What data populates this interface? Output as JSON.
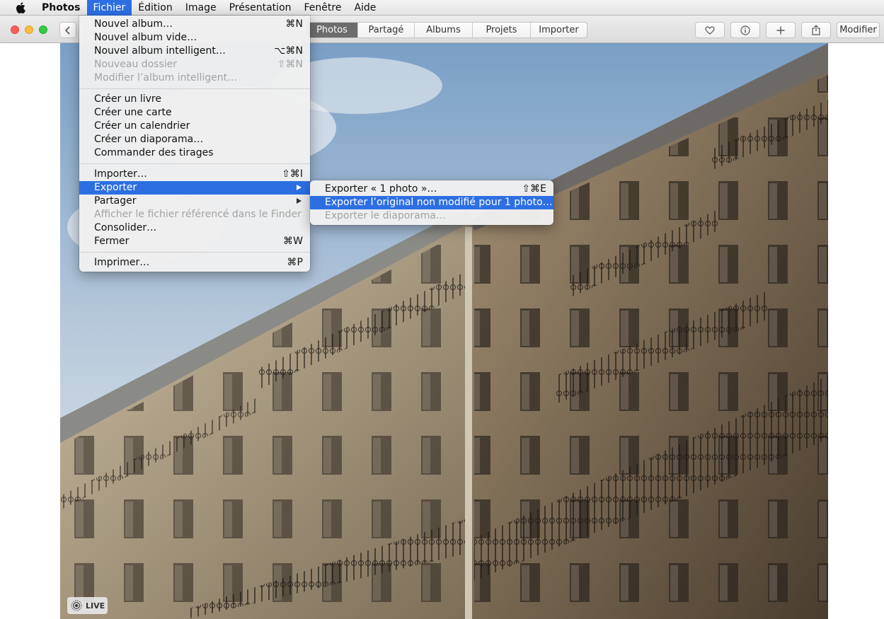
{
  "menubar": {
    "apple_icon": "apple-logo-icon",
    "items": [
      {
        "label": "Photos",
        "bold": true
      },
      {
        "label": "Fichier",
        "open": true
      },
      {
        "label": "Édition"
      },
      {
        "label": "Image"
      },
      {
        "label": "Présentation"
      },
      {
        "label": "Fenêtre"
      },
      {
        "label": "Aide"
      }
    ]
  },
  "toolbar": {
    "back_icon": "chevron-left-icon",
    "tabs": [
      {
        "label": "Photos",
        "active": true
      },
      {
        "label": "Partagé"
      },
      {
        "label": "Albums"
      },
      {
        "label": "Projets"
      },
      {
        "label": "Importer"
      }
    ],
    "favorite_icon": "heart-icon",
    "info_icon": "info-icon",
    "add_icon": "plus-icon",
    "share_icon": "share-icon",
    "edit_label": "Modifier"
  },
  "photo": {
    "live_label": "LIVE",
    "live_icon": "live-photo-icon"
  },
  "file_menu": {
    "items": [
      {
        "label": "Nouvel album…",
        "shortcut": "⌘N"
      },
      {
        "label": "Nouvel album vide…",
        "shortcut": ""
      },
      {
        "label": "Nouvel album intelligent…",
        "shortcut": "⌥⌘N"
      },
      {
        "label": "Nouveau dossier",
        "shortcut": "⇧⌘N",
        "disabled": true
      },
      {
        "label": "Modifier l’album intelligent…",
        "shortcut": "",
        "disabled": true
      },
      {
        "label": "Créer un livre"
      },
      {
        "label": "Créer une carte"
      },
      {
        "label": "Créer un calendrier"
      },
      {
        "label": "Créer un diaporama…"
      },
      {
        "label": "Commander des tirages"
      },
      {
        "label": "Importer…",
        "shortcut": "⇧⌘I"
      },
      {
        "label": "Exporter",
        "highlighted": true,
        "submenu": true
      },
      {
        "label": "Partager",
        "submenu": true
      },
      {
        "label": "Afficher le fichier référencé dans le Finder",
        "disabled": true
      },
      {
        "label": "Consolider…"
      },
      {
        "label": "Fermer",
        "shortcut": "⌘W"
      },
      {
        "label": "Imprimer…",
        "shortcut": "⌘P"
      }
    ]
  },
  "export_submenu": {
    "items": [
      {
        "label": "Exporter « 1 photo »…",
        "shortcut": "⇧⌘E"
      },
      {
        "label": "Exporter l’original non modifié pour 1 photo…",
        "highlighted": true
      },
      {
        "label": "Exporter le diaporama…",
        "disabled": true
      }
    ]
  },
  "colors": {
    "menu_highlight": "#2d6fe3",
    "active_tab": "#6d6d6d",
    "close": "#fc605c",
    "minimize": "#fdbc40",
    "zoom": "#34c84a"
  }
}
